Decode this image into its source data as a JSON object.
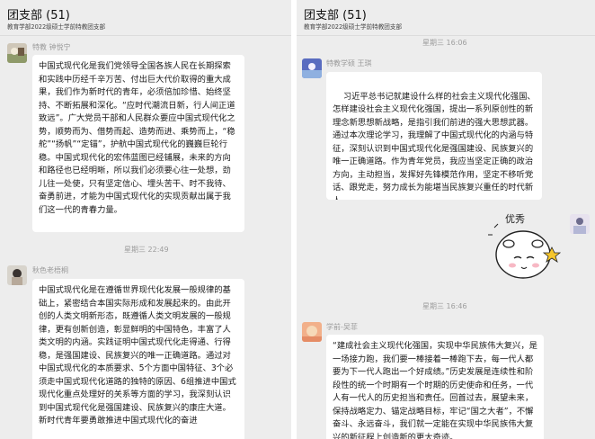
{
  "left": {
    "header": {
      "title": "团支部 (51)",
      "subtitle": "教育学部2022级硕士学前特教团支部"
    },
    "msg1": {
      "sender": "特教 钟悦宁",
      "text": "中国式现代化是我们党领导全国各族人民在长期探索和实践中历经千辛万苦、付出巨大代价取得的重大成果，我们作为新时代的青年，必须倍加珍惜、始终坚持、不断拓展和深化。“应时代潮流日新，行人间正道致远”。广大党员干部和人民群众要应中国式现代化之势，顺势而为、借势而起、造势而进、乘势而上，“稳舵”“扬帆”“定锚”，护航中国式现代化的巍巍巨轮行稳。中国式现代化的宏伟蓝图已经铺展，未来的方向和路径也已经明晰，所以我们必须要心往一处想，劲儿往一处使，只有坚定信心、埋头苦干、时不我待、奋勇前进，才能为中国式现代化的实现贡献出属于我们这一代的青春力量。"
    },
    "time1": "星期三 22:49",
    "msg2": {
      "sender": "秋色老梧桐",
      "text": "中国式现代化是在遵循世界现代化发展一般规律的基础上，紧密结合本国实际形成和发展起来的。由此开创的人类文明新形态，既遵循人类文明发展的一般规律，更有创新创造，彰显鲜明的中国特色，丰富了人类文明的内涵。实践证明中国式现代化走得通、行得稳，是强国建设、民族复兴的唯一正确道路。通过对中国式现代化的本质要求、5个方面中国特征、3个必须走中国式现代化道路的独特的原因、6组推进中国式现代化重点处理好的关系等方面的学习，我深刻认识到中国式现代化是强国建设、民族复兴的康庄大道。新时代青年要勇敢推进中国式现代化的奋进"
    }
  },
  "right": {
    "header": {
      "title": "团支部 (51)",
      "subtitle": "教育学部2022级硕士学前特教团支部"
    },
    "time0": "星期三 16:06",
    "msg1": {
      "sender": "特教学硕 王琪",
      "text": "习近平总书记就建设什么样的社会主义现代化强国、怎样建设社会主义现代化强国，提出一系列原创性的新理念新思想新战略，是指引我们前进的强大思想武器。\n通过本次理论学习，我理解了中国式现代化的内涵与特征，深刻认识到中国式现代化是强国建设、民族复兴的唯一正确道路。作为青年党员，我应当坚定正确的政治方向，主动担当，发挥好先锋模范作用，坚定不移听党话、跟党走，努力成长为能堪当民族复兴重任的时代新人。"
    },
    "sticker_text": "优秀",
    "time1": "星期三 16:46",
    "msg2": {
      "sender": "学前-吴菲",
      "text": "“建成社会主义现代化强国，实现中华民族伟大复兴，是一场接力跑，我们要一棒接着一棒跑下去，每一代人都要为下一代人跑出一个好成绩。”历史发展是连续性和阶段性的统一个时期有一个时期的历史使命和任务，一代人有一代人的历史担当和责任。回首过去，展望未来，保持战略定力、锚定战略目标，牢记“国之大者”，不懈奋斗、永远奋斗，我们就一定能在实现中华民族伟大复兴的新征程上创造新的更大奇迹。"
    }
  },
  "colors": {
    "bg": "#ededed",
    "bubble": "#ffffff",
    "meta": "#9a9a9a"
  }
}
